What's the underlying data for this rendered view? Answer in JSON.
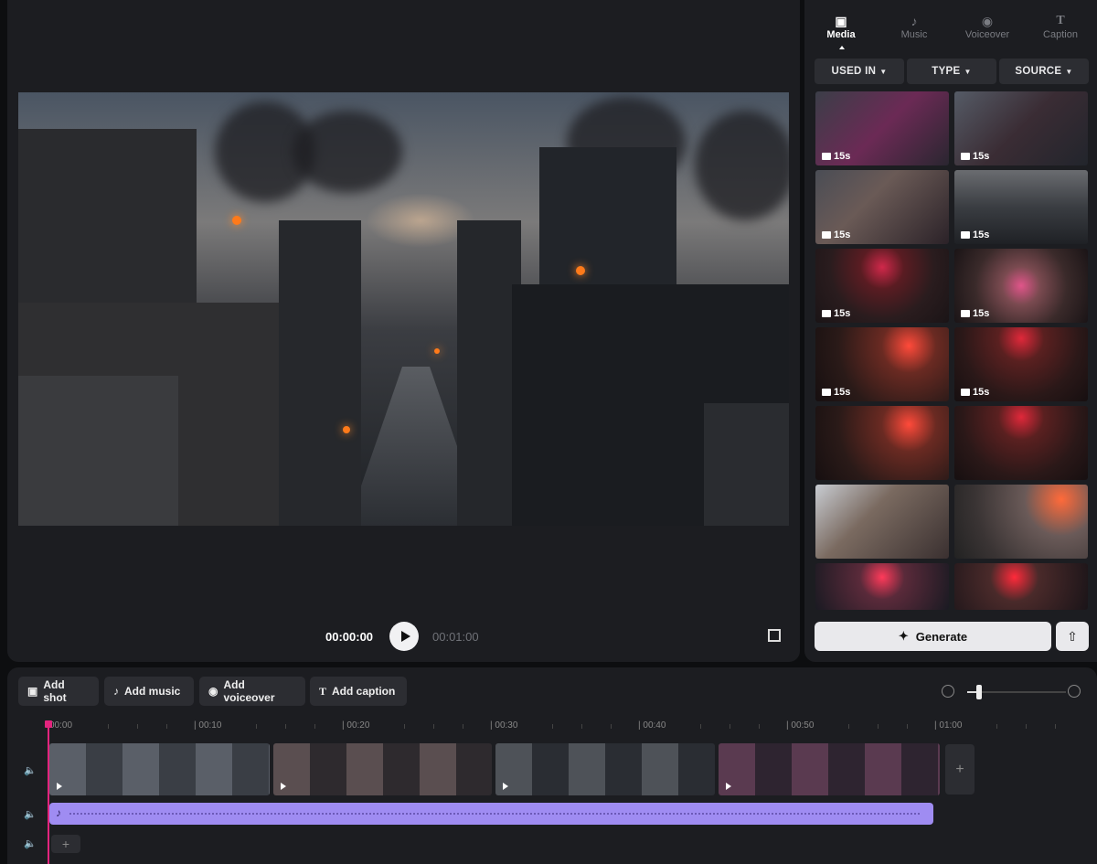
{
  "player": {
    "current_time": "00:00:00",
    "total_time": "00:01:00"
  },
  "side_tabs": [
    {
      "label": "Media",
      "icon": "media-icon",
      "active": true
    },
    {
      "label": "Music",
      "icon": "music-note-icon",
      "active": false
    },
    {
      "label": "Voiceover",
      "icon": "microphone-icon",
      "active": false
    },
    {
      "label": "Caption",
      "icon": "text-icon",
      "active": false
    }
  ],
  "filters": [
    {
      "label": "USED IN"
    },
    {
      "label": "TYPE"
    },
    {
      "label": "SOURCE"
    }
  ],
  "media": [
    {
      "duration": "15s"
    },
    {
      "duration": "15s"
    },
    {
      "duration": "15s"
    },
    {
      "duration": "15s"
    },
    {
      "duration": "15s"
    },
    {
      "duration": "15s"
    },
    {
      "duration": "15s"
    },
    {
      "duration": "15s"
    },
    {
      "duration": ""
    },
    {
      "duration": ""
    },
    {
      "duration": ""
    },
    {
      "duration": ""
    },
    {
      "duration": ""
    },
    {
      "duration": ""
    }
  ],
  "generate_label": "Generate",
  "timeline": {
    "buttons": [
      {
        "label": "Add shot",
        "icon": "clapper-icon"
      },
      {
        "label": "Add music",
        "icon": "music-note-icon"
      },
      {
        "label": "Add voiceover",
        "icon": "microphone-icon"
      },
      {
        "label": "Add caption",
        "icon": "text-icon"
      }
    ],
    "ruler": [
      "00:00",
      "| 00:10",
      "| 00:20",
      "| 00:30",
      "| 00:40",
      "| 00:50",
      "| 01:00"
    ]
  },
  "colors": {
    "accent_playhead": "#e3247e",
    "music_track": "#9f8cf2",
    "panel_bg": "#1c1d21"
  }
}
